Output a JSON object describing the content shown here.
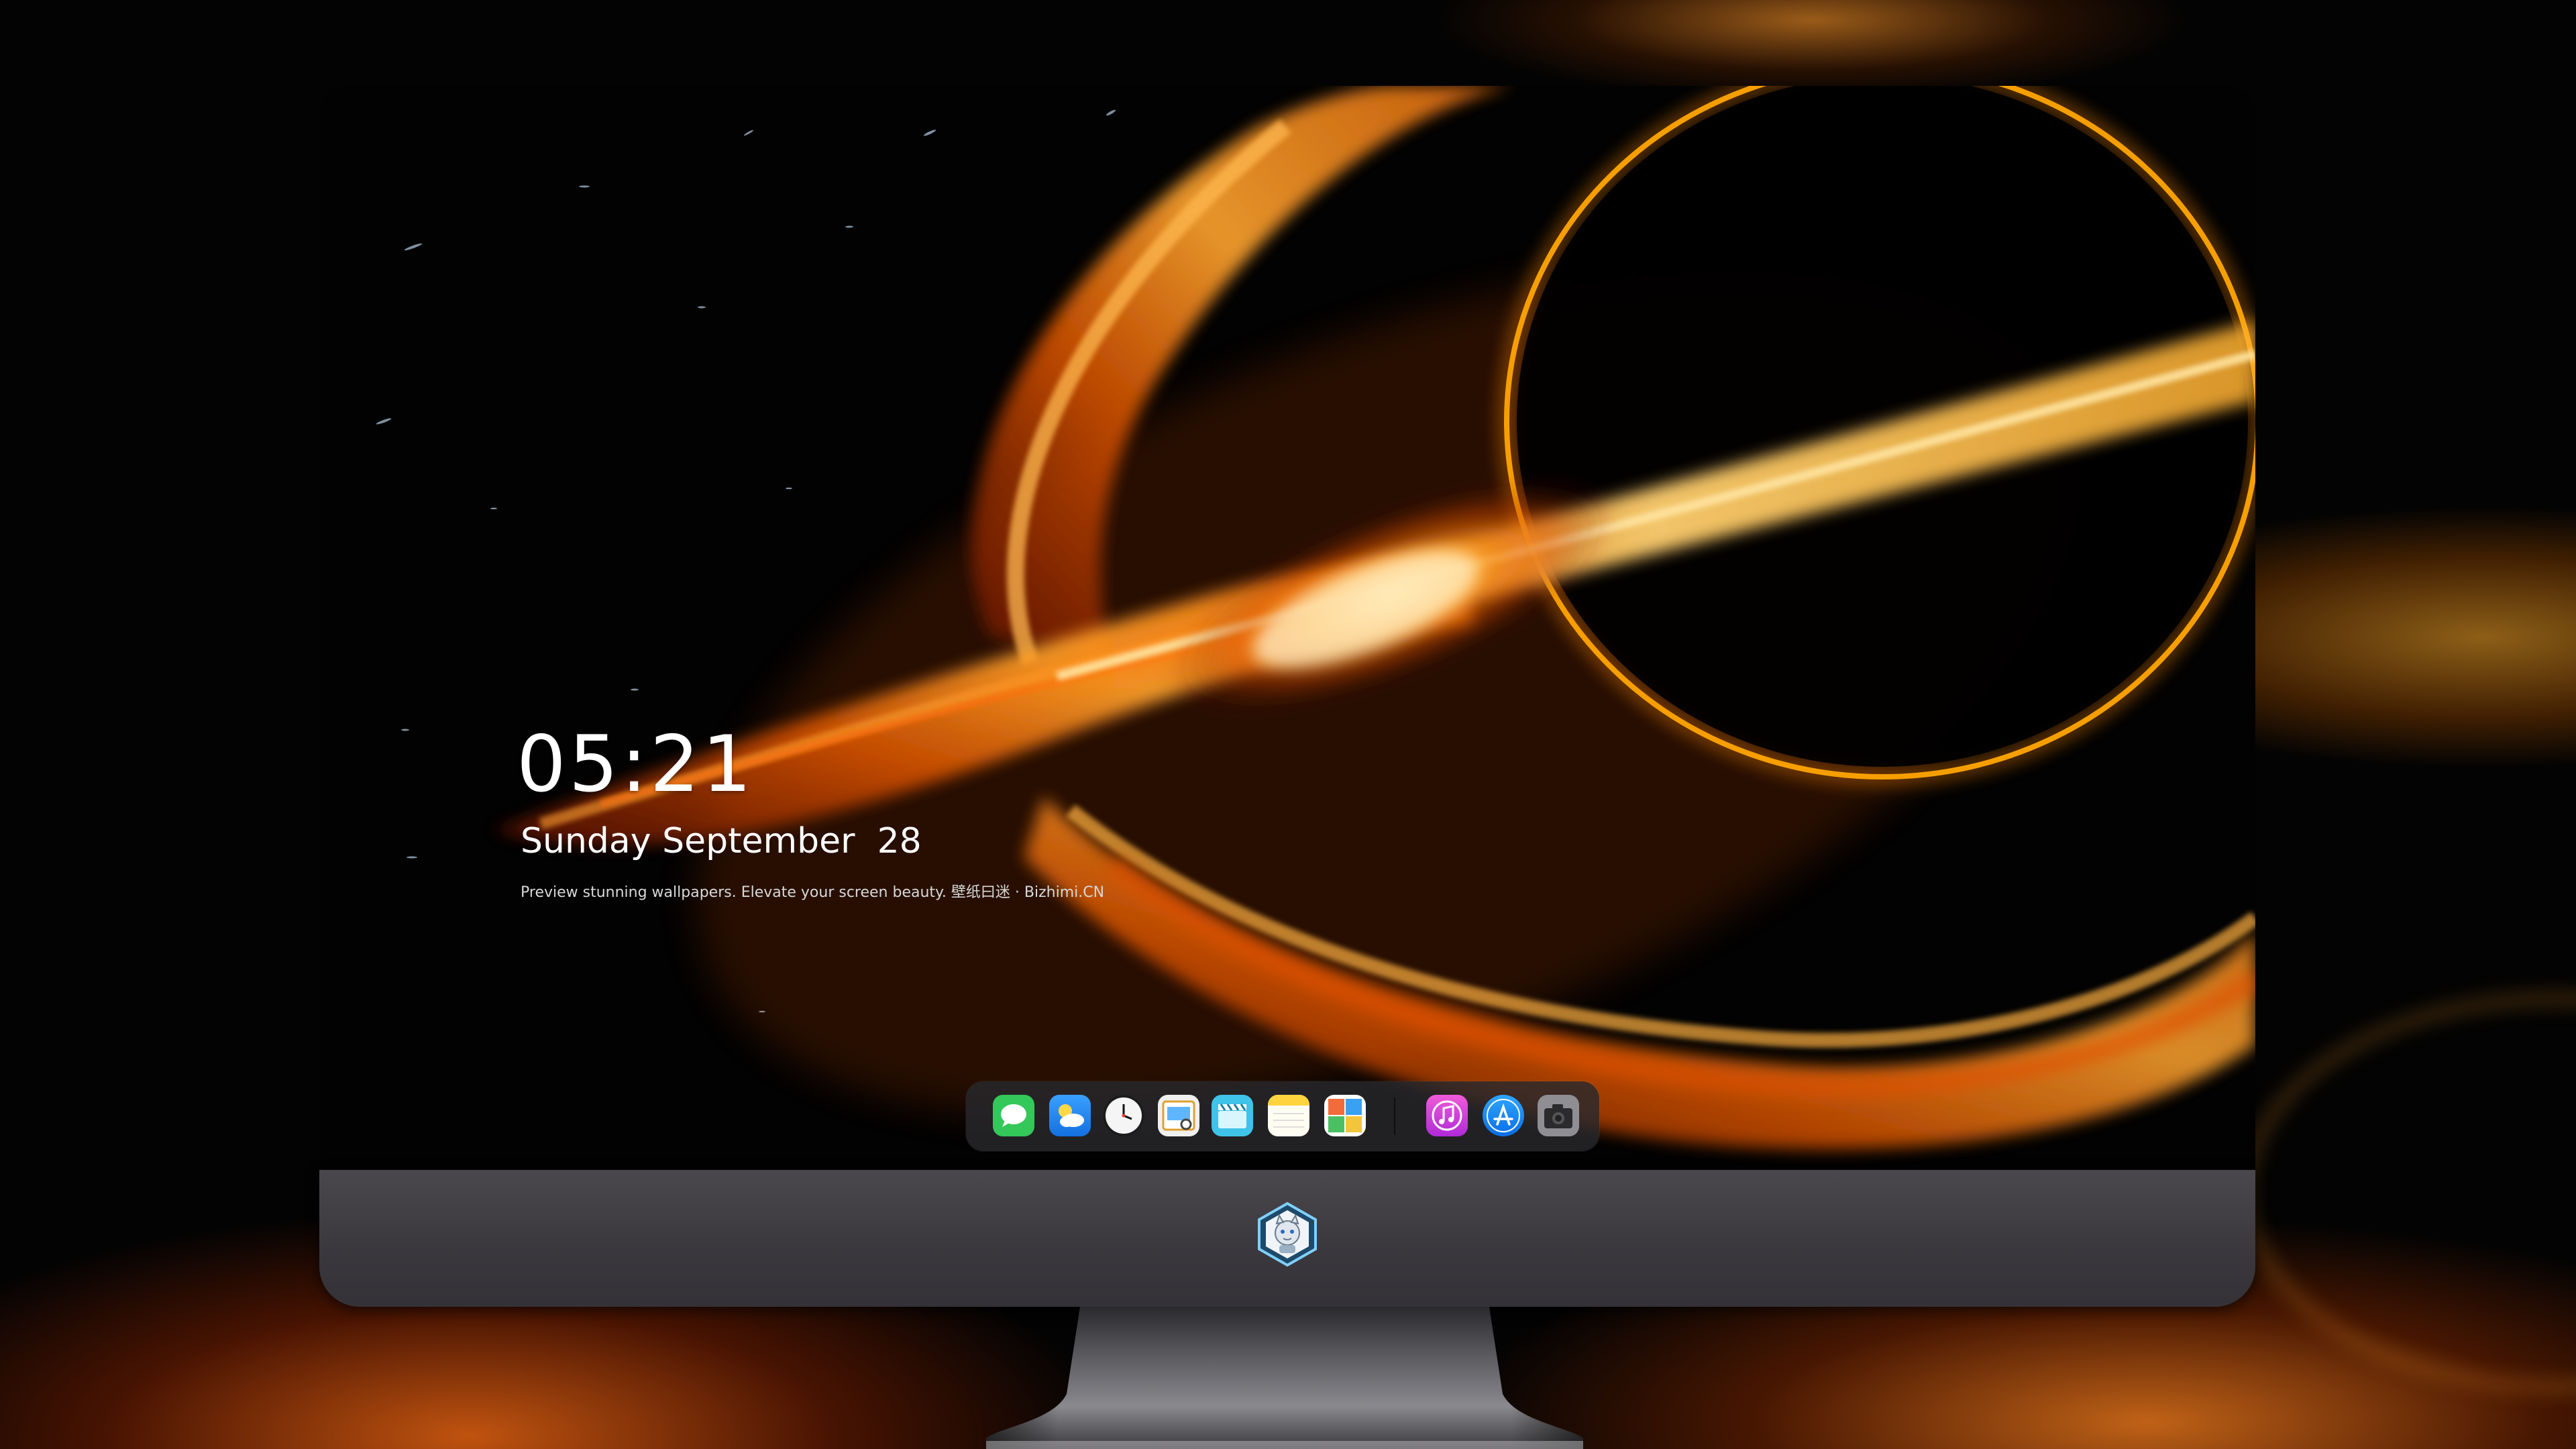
{
  "lockscreen": {
    "time": "05:21",
    "date": "Sunday September  28",
    "tagline": "Preview stunning wallpapers. Elevate your screen beauty. 壁纸曰迷 · Bizhimi.CN"
  },
  "dock": {
    "apps": [
      {
        "name": "Messages",
        "icon": "messages-icon",
        "color": "#34c759"
      },
      {
        "name": "Weather",
        "icon": "weather-icon",
        "color": "#1e90ff"
      },
      {
        "name": "Clock",
        "icon": "clock-icon",
        "color": "#f2f2f2"
      },
      {
        "name": "Preview",
        "icon": "preview-icon",
        "color": "#e8b23a"
      },
      {
        "name": "Clips",
        "icon": "clapperboard-icon",
        "color": "#3fc3e8"
      },
      {
        "name": "Notes",
        "icon": "notes-icon",
        "color": "#ffd33d"
      },
      {
        "name": "Photo Booth",
        "icon": "photo-booth-icon",
        "color": "#f26b3a"
      },
      {
        "name": "Music",
        "icon": "music-icon",
        "color": "#e040c0"
      },
      {
        "name": "App Store",
        "icon": "app-store-icon",
        "color": "#1a8cff"
      },
      {
        "name": "Camera",
        "icon": "camera-icon",
        "color": "#7a7a7e"
      }
    ]
  },
  "colors": {
    "accent_orange": "#ff8a1c",
    "ring_gold": "#ffb200",
    "bezel": "#3d3b40"
  }
}
